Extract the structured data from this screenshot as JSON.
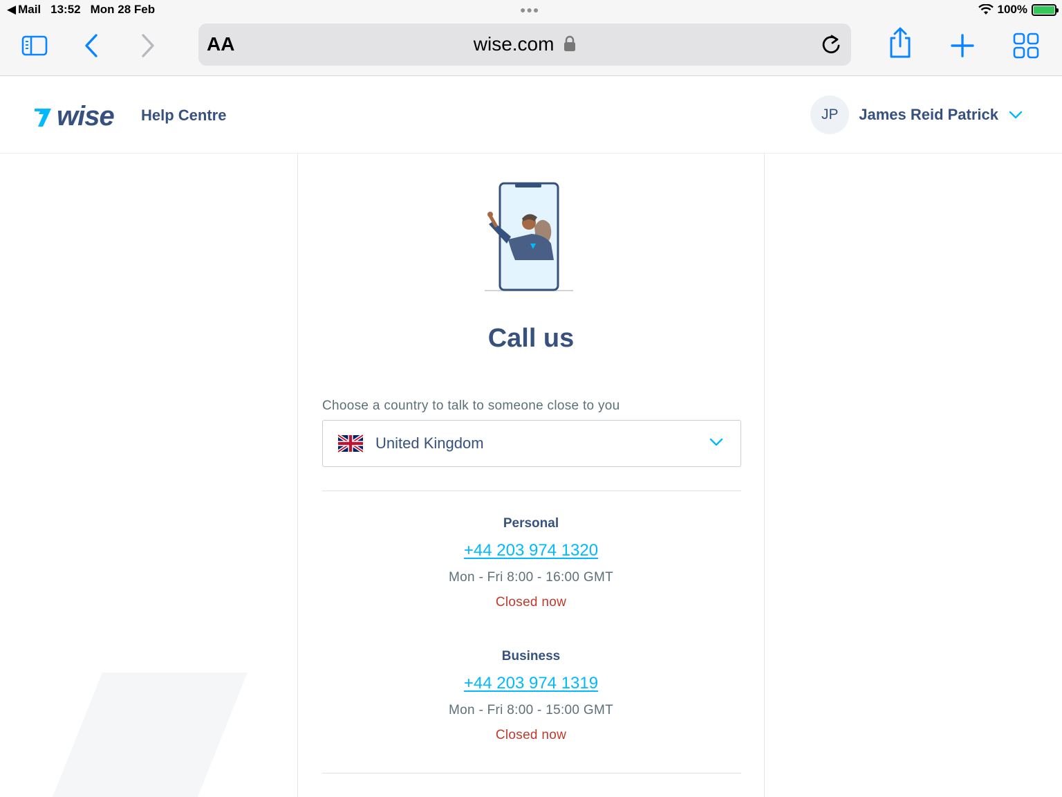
{
  "status_bar": {
    "back_app": "Mail",
    "time": "13:52",
    "date": "Mon 28 Feb",
    "battery": "100%"
  },
  "browser": {
    "text_size_label": "AA",
    "url": "wise.com",
    "icons": [
      "sidebar-icon",
      "back-icon",
      "forward-icon",
      "lock-icon",
      "reload-icon",
      "share-icon",
      "new-tab-icon",
      "tabs-grid-icon"
    ]
  },
  "header": {
    "brand": "wise",
    "section": "Help Centre",
    "user_initials": "JP",
    "user_name": "James Reid Patrick"
  },
  "contact": {
    "title": "Call us",
    "choose_label": "Choose a country to talk to someone close to you",
    "selected_country": "United Kingdom",
    "lines": [
      {
        "label": "Personal",
        "phone": "+44 203 974 1320",
        "hours": "Mon - Fri 8:00 - 16:00 GMT",
        "status": "Closed now"
      },
      {
        "label": "Business",
        "phone": "+44 203 974 1319",
        "hours": "Mon - Fri 8:00 - 15:00 GMT",
        "status": "Closed now"
      }
    ]
  },
  "colors": {
    "brand_navy": "#37517e",
    "accent_blue": "#00b9ff",
    "safari_blue": "#0a84ff",
    "closed_red": "#c0392b"
  }
}
